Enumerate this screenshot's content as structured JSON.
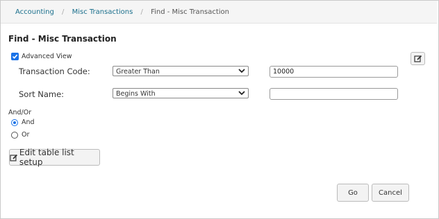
{
  "breadcrumb": {
    "items": [
      "Accounting",
      "Misc Transactions"
    ],
    "current": "Find - Misc Transaction",
    "separator": "/"
  },
  "page_title": "Find - Misc Transaction",
  "advanced_view": {
    "label": "Advanced View",
    "checked": true
  },
  "fields": [
    {
      "label": "Transaction Code:",
      "operator": "Greater Than",
      "value": "10000"
    },
    {
      "label": "Sort Name:",
      "operator": "Begins With",
      "value": ""
    }
  ],
  "andor": {
    "label": "And/Or",
    "options": [
      {
        "label": "And",
        "selected": true
      },
      {
        "label": "Or",
        "selected": false
      }
    ]
  },
  "edit_list_label": "Edit table list setup",
  "buttons": {
    "go": "Go",
    "cancel": "Cancel"
  },
  "colors": {
    "link": "#1a6f8c",
    "accent": "#1a73e8"
  },
  "icons": [
    "edit-icon",
    "chevron-down-icon",
    "checkmark-icon"
  ]
}
